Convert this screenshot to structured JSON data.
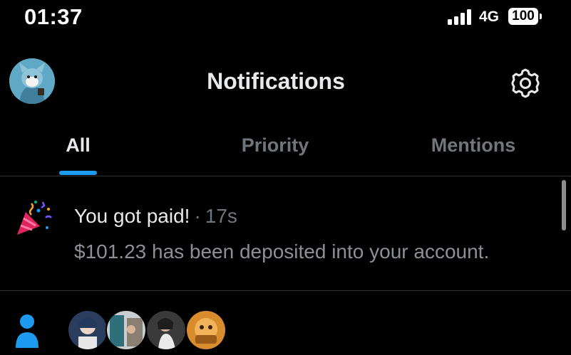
{
  "status_bar": {
    "time": "01:37",
    "network": "4G",
    "battery": "100",
    "icons": [
      "signal-bars-icon",
      "battery-icon"
    ]
  },
  "header": {
    "title": "Notifications",
    "icons": [
      "avatar-image",
      "gear-icon"
    ]
  },
  "tabs": [
    {
      "label": "All",
      "active": true
    },
    {
      "label": "Priority",
      "active": false
    },
    {
      "label": "Mentions",
      "active": false
    }
  ],
  "notifications": [
    {
      "icon": "party-popper-icon",
      "title": "You got paid!",
      "separator": "·",
      "time": "17s",
      "body": "$101.23 has been deposited into your account."
    },
    {
      "icon": "person-icon",
      "avatars": [
        "user-avatar-1",
        "user-avatar-2",
        "user-avatar-3",
        "user-avatar-4"
      ]
    }
  ],
  "colors": {
    "background": "#000000",
    "accent": "#1d9bf0",
    "text_primary": "#e7e9ea",
    "text_secondary": "#71767b",
    "divider": "#2f3336"
  }
}
